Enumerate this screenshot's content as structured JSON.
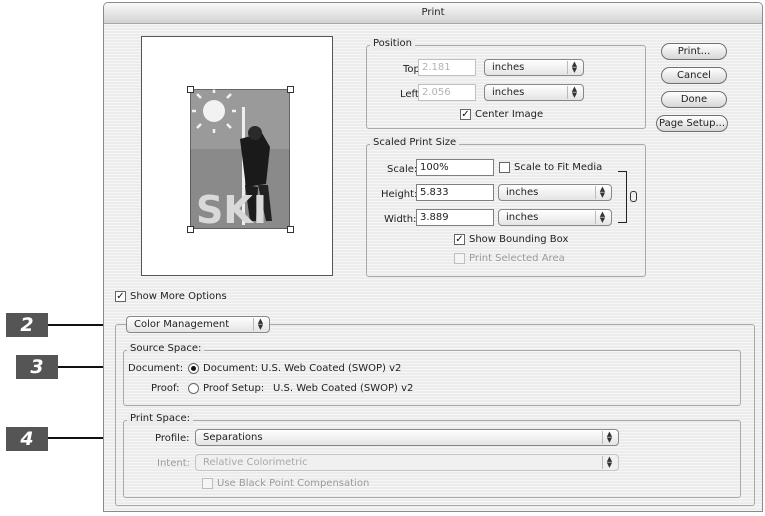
{
  "window": {
    "title": "Print"
  },
  "preview": {
    "image_text": "SKI"
  },
  "position": {
    "title": "Position",
    "top_label": "Top:",
    "top_value": "2.181",
    "top_unit": "inches",
    "left_label": "Left:",
    "left_value": "2.056",
    "left_unit": "inches",
    "center_label": "Center Image"
  },
  "scaled": {
    "title": "Scaled Print Size",
    "scale_label": "Scale:",
    "scale_value": "100%",
    "fit_label": "Scale to Fit Media",
    "height_label": "Height:",
    "height_value": "5.833",
    "height_unit": "inches",
    "width_label": "Width:",
    "width_value": "3.889",
    "width_unit": "inches",
    "bbox_label": "Show Bounding Box",
    "selected_label": "Print Selected Area"
  },
  "buttons": {
    "print": "Print...",
    "cancel": "Cancel",
    "done": "Done",
    "page_setup": "Page Setup..."
  },
  "more_options_label": "Show More Options",
  "color_mgmt": {
    "popup": "Color Management"
  },
  "source": {
    "title": "Source Space:",
    "document_label": "Document:",
    "document_option": "Document:",
    "document_profile": "U.S. Web Coated (SWOP) v2",
    "proof_label": "Proof:",
    "proof_option": "Proof Setup:",
    "proof_profile": "U.S. Web Coated (SWOP) v2"
  },
  "print_space": {
    "title": "Print Space:",
    "profile_label": "Profile:",
    "profile_value": "Separations",
    "intent_label": "Intent:",
    "intent_value": "Relative Colorimetric",
    "bpc_label": "Use Black Point Compensation"
  },
  "callouts": {
    "c2": "2",
    "c3": "3",
    "c4": "4"
  }
}
